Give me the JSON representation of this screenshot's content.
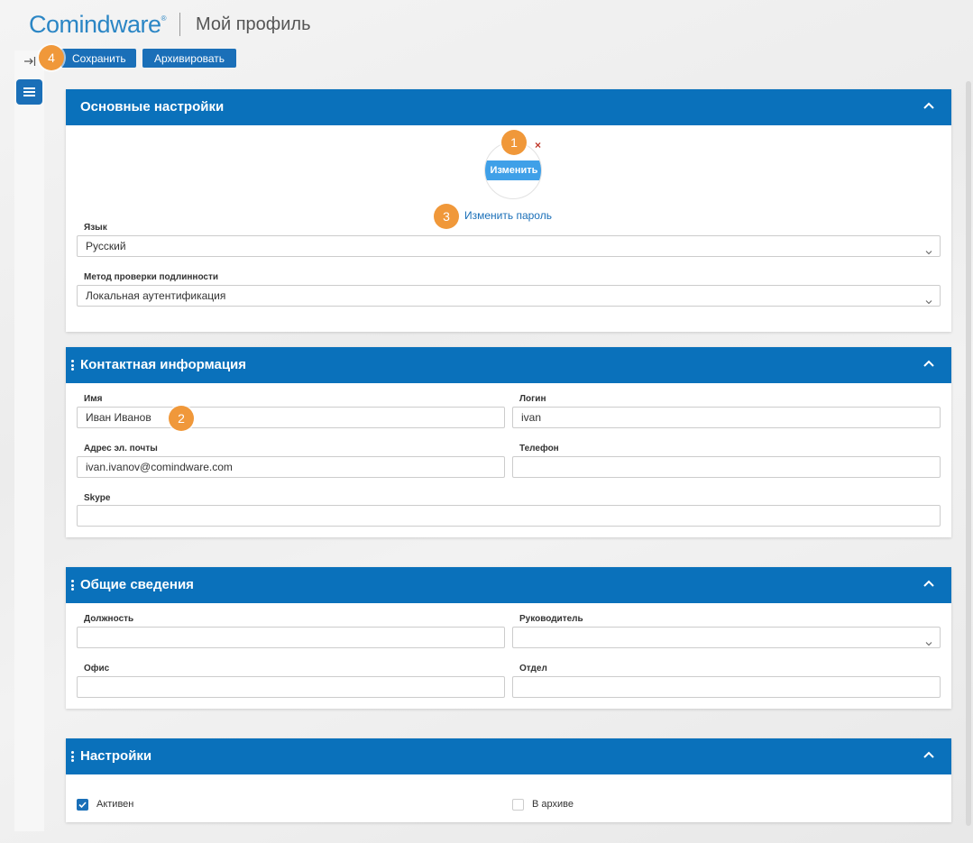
{
  "header": {
    "logo_text": "Comindware",
    "logo_mark": "®",
    "page_title": "Мой профиль"
  },
  "toolbar": {
    "save_label": "Сохранить",
    "archive_label": "Архивировать"
  },
  "badges": [
    "1",
    "2",
    "3",
    "4"
  ],
  "sections": {
    "basic": {
      "title": "Основные настройки",
      "avatar_button": "Изменить",
      "remove_mark": "×",
      "change_password": "Изменить пароль",
      "language_label": "Язык",
      "language_value": "Русский",
      "auth_label": "Метод проверки подлинности",
      "auth_value": "Локальная аутентификация"
    },
    "contact": {
      "title": "Контактная информация",
      "name_label": "Имя",
      "name_value": "Иван Иванов",
      "login_label": "Логин",
      "login_value": "ivan",
      "email_label": "Адрес эл. почты",
      "email_value": "ivan.ivanov@comindware.com",
      "phone_label": "Телефон",
      "phone_value": "",
      "skype_label": "Skype",
      "skype_value": ""
    },
    "general": {
      "title": "Общие сведения",
      "position_label": "Должность",
      "position_value": "",
      "manager_label": "Руководитель",
      "manager_value": "",
      "office_label": "Офис",
      "office_value": "",
      "department_label": "Отдел",
      "department_value": ""
    },
    "settings": {
      "title": "Настройки",
      "active_label": "Активен",
      "active_checked": true,
      "archived_label": "В архиве",
      "archived_checked": false
    }
  },
  "icons": {
    "collapse": "collapse-sidebar-icon",
    "menu": "hamburger-menu-icon",
    "chevron_up": "chevron-up-icon",
    "chevron_down": "chevron-down-icon",
    "drag": "drag-handle-icon",
    "check": "check-icon"
  },
  "colors": {
    "brand": "#2b86c5",
    "panel_header": "#0a71bb",
    "button": "#1a6fb8",
    "badge": "#f0983a",
    "avatar_button": "#3fa0e8"
  }
}
